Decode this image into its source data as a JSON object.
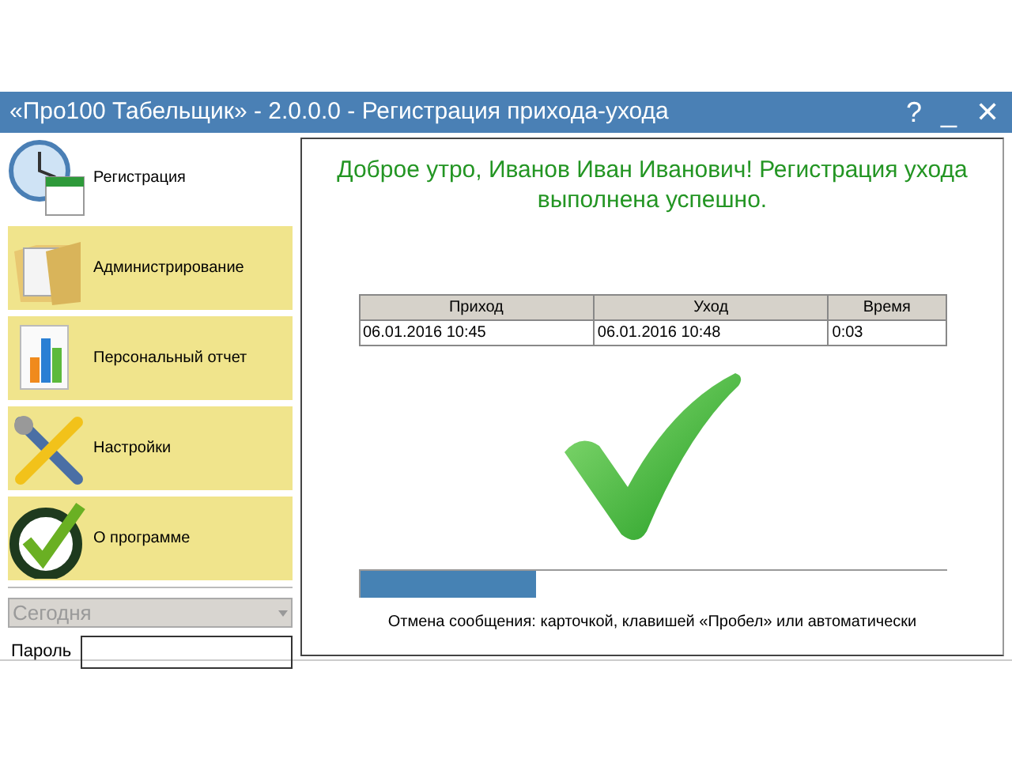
{
  "window": {
    "title": "«Про100 Табельщик» - 2.0.0.0 - Регистрация прихода-ухода",
    "controls": [
      "?",
      "_",
      "✕"
    ]
  },
  "menu": [
    {
      "label": "Регистрация",
      "kind": "clock-calendar",
      "selected": true
    },
    {
      "label": "Администрирование",
      "kind": "folder",
      "selected": false
    },
    {
      "label": "Персональный отчет",
      "kind": "report",
      "selected": false
    },
    {
      "label": "Настройки",
      "kind": "tools",
      "selected": false
    },
    {
      "label": "О программе",
      "kind": "clock-check",
      "selected": false
    }
  ],
  "period": {
    "value": "Сегодня",
    "disabled": true
  },
  "password": {
    "label": "Пароль"
  },
  "message": "Доброе утро, Иванов Иван Иванович! Регистрация ухода выполнена успешно.",
  "table": {
    "columns": [
      "Приход",
      "Уход",
      "Время"
    ],
    "rows": [
      [
        "06.01.2016 10:45",
        "06.01.2016 10:48",
        "0:03"
      ]
    ]
  },
  "progress": {
    "level": 0.3
  },
  "hint": "Отмена сообщения: карточкой, клавишей «Пробел» или автоматически"
}
